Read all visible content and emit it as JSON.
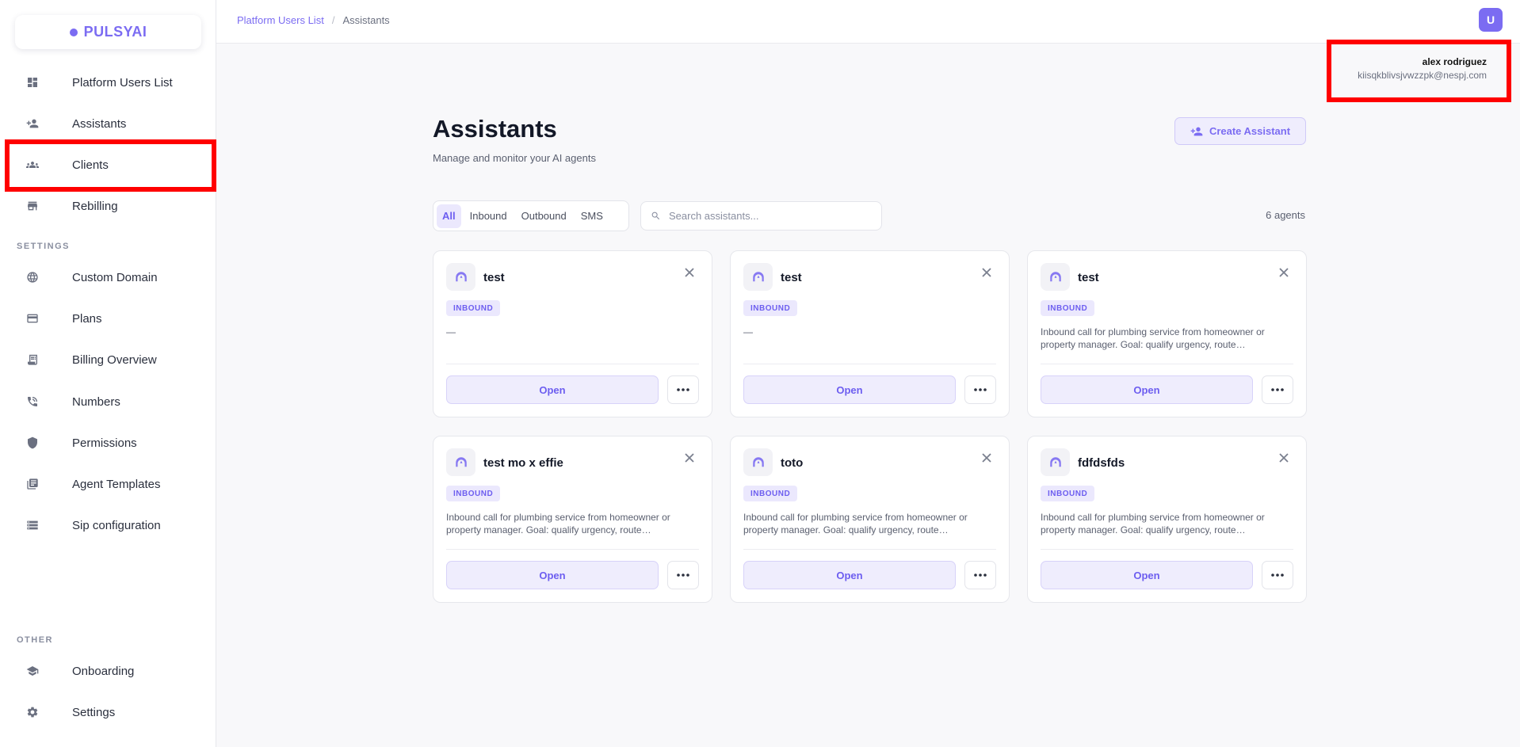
{
  "brand": {
    "name": "PULSYAI"
  },
  "sidebar": {
    "items": [
      {
        "label": "Platform Users List",
        "icon": "dashboard-icon"
      },
      {
        "label": "Assistants",
        "icon": "person-add-icon"
      },
      {
        "label": "Clients",
        "icon": "group-icon"
      },
      {
        "label": "Rebilling",
        "icon": "store-icon"
      }
    ],
    "settings_label": "SETTINGS",
    "settings_items": [
      {
        "label": "Custom Domain",
        "icon": "globe-icon"
      },
      {
        "label": "Plans",
        "icon": "credit-card-icon"
      },
      {
        "label": "Billing Overview",
        "icon": "receipt-icon"
      },
      {
        "label": "Numbers",
        "icon": "phone-icon"
      },
      {
        "label": "Permissions",
        "icon": "shield-icon"
      },
      {
        "label": "Agent Templates",
        "icon": "library-icon"
      },
      {
        "label": "Sip configuration",
        "icon": "storage-icon"
      }
    ],
    "other_label": "OTHER",
    "other_items": [
      {
        "label": "Onboarding",
        "icon": "school-icon"
      },
      {
        "label": "Settings",
        "icon": "gear-icon"
      }
    ]
  },
  "topbar": {
    "breadcrumb": {
      "parent": "Platform Users List",
      "separator": "/",
      "current": "Assistants"
    },
    "avatar_letter": "U"
  },
  "user": {
    "name": "alex rodriguez",
    "email": "kiisqkblivsjvwzzpk@nespj.com"
  },
  "main": {
    "title": "Assistants",
    "subtitle": "Manage and monitor your AI agents",
    "create_label": "Create Assistant",
    "filters": [
      "All",
      "Inbound",
      "Outbound",
      "SMS"
    ],
    "search_placeholder": "Search assistants...",
    "agent_count": "6 agents"
  },
  "cards": [
    {
      "title": "test",
      "badge": "INBOUND",
      "desc_line1": "—",
      "desc_line2": "",
      "open": "Open"
    },
    {
      "title": "test",
      "badge": "INBOUND",
      "desc_line1": "—",
      "desc_line2": "",
      "open": "Open"
    },
    {
      "title": "test",
      "badge": "INBOUND",
      "desc_line1": "Inbound call for plumbing service from homeowner or",
      "desc_line2": "property manager. Goal: qualify urgency, route…",
      "open": "Open"
    },
    {
      "title": "test mo x effie",
      "badge": "INBOUND",
      "desc_line1": "Inbound call for plumbing service from homeowner or",
      "desc_line2": "property manager. Goal: qualify urgency, route…",
      "open": "Open"
    },
    {
      "title": "toto",
      "badge": "INBOUND",
      "desc_line1": "Inbound call for plumbing service from homeowner or",
      "desc_line2": "property manager. Goal: qualify urgency, route…",
      "open": "Open"
    },
    {
      "title": "fdfdsfds",
      "badge": "INBOUND",
      "desc_line1": "Inbound call for plumbing service from homeowner or",
      "desc_line2": "property manager. Goal: qualify urgency, route…",
      "open": "Open"
    }
  ],
  "colors": {
    "accent": "#7b6cf2",
    "highlight": "#ff0000"
  }
}
